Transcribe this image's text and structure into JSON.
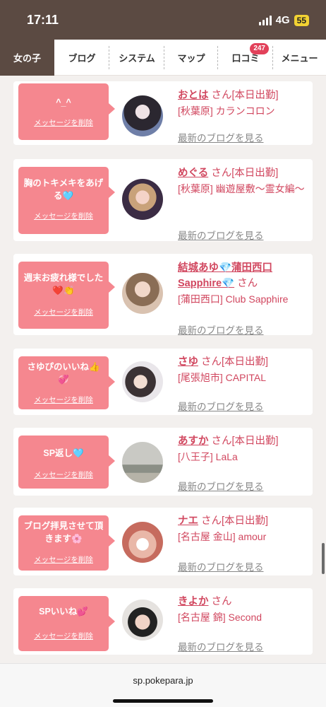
{
  "status": {
    "time": "17:11",
    "network": "4G",
    "battery": "55"
  },
  "nav": {
    "tabs": [
      {
        "label": "女の子"
      },
      {
        "label": "ブログ"
      },
      {
        "label": "システム"
      },
      {
        "label": "マップ"
      },
      {
        "label": "口コミ",
        "badge": "247"
      },
      {
        "label": "メニュー"
      }
    ]
  },
  "cards": [
    {
      "message": "^_^",
      "delete_label": "メッセージを削除",
      "name": "おとは",
      "san": "さん",
      "status": "[本日出勤]",
      "location": "[秋葉原] カランコロン",
      "blog_link": "最新のブログを見る"
    },
    {
      "message": "胸のトキメキをあげる🩵",
      "delete_label": "メッセージを削除",
      "name": "めぐる",
      "san": "さん",
      "status": "[本日出勤]",
      "location": "[秋葉原] 幽遊屋敷～霊女編～",
      "blog_link": "最新のブログを見る"
    },
    {
      "message": "週末お疲れ様でした❤️👏",
      "delete_label": "メッセージを削除",
      "name": "結城あゆ💎蒲田西口Sapphire💎",
      "san": "さん",
      "status": "",
      "location": "[蒲田西口] Club Sapphire",
      "blog_link": "最新のブログを見る"
    },
    {
      "message": "さゆぴのいいね👍💞",
      "delete_label": "メッセージを削除",
      "name": "さゆ",
      "san": "さん",
      "status": "[本日出勤]",
      "location": "[尾張旭市] CAPITAL",
      "blog_link": "最新のブログを見る"
    },
    {
      "message": "SP返し🩵",
      "delete_label": "メッセージを削除",
      "name": "あすか",
      "san": "さん",
      "status": "[本日出勤]",
      "location": "[八王子] LaLa",
      "blog_link": "最新のブログを見る"
    },
    {
      "message": "ブログ拝見させて頂きます🌸",
      "delete_label": "メッセージを削除",
      "name": "ナエ",
      "san": "さん",
      "status": "[本日出勤]",
      "location": "[名古屋 金山] amour",
      "blog_link": "最新のブログを見る"
    },
    {
      "message": "SPいいね💕",
      "delete_label": "メッセージを削除",
      "name": "きよか",
      "san": "さん",
      "status": "",
      "location": "[名古屋 錦] Second",
      "blog_link": "最新のブログを見る"
    }
  ],
  "footer": {
    "url": "sp.pokepara.jp"
  },
  "colors": {
    "accent": "#d1475f",
    "bubble": "#f5878f",
    "nav_active": "#5b4a42"
  }
}
